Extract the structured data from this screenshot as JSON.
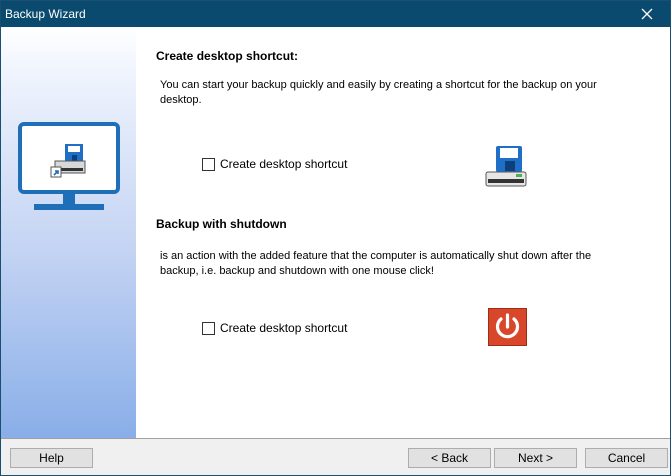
{
  "window": {
    "title": "Backup Wizard"
  },
  "sections": [
    {
      "heading": "Create desktop shortcut:",
      "description": "You can start your backup quickly and easily by creating a shortcut for the backup on your desktop.",
      "checkbox_label": "Create desktop shortcut",
      "checked": false,
      "icon": "floppy-drive-icon"
    },
    {
      "heading": "Backup with shutdown",
      "description": "is an action with the added feature that the computer is automatically shut down after the backup, i.e. backup and shutdown with one mouse click!",
      "checkbox_label": "Create desktop shortcut",
      "checked": false,
      "icon": "power-icon"
    }
  ],
  "footer": {
    "help": "Help",
    "back": "< Back",
    "next": "Next >",
    "cancel": "Cancel"
  },
  "colors": {
    "titlebar": "#0a4a6e",
    "monitor": "#1e6fb8",
    "power_button": "#d9472b"
  }
}
